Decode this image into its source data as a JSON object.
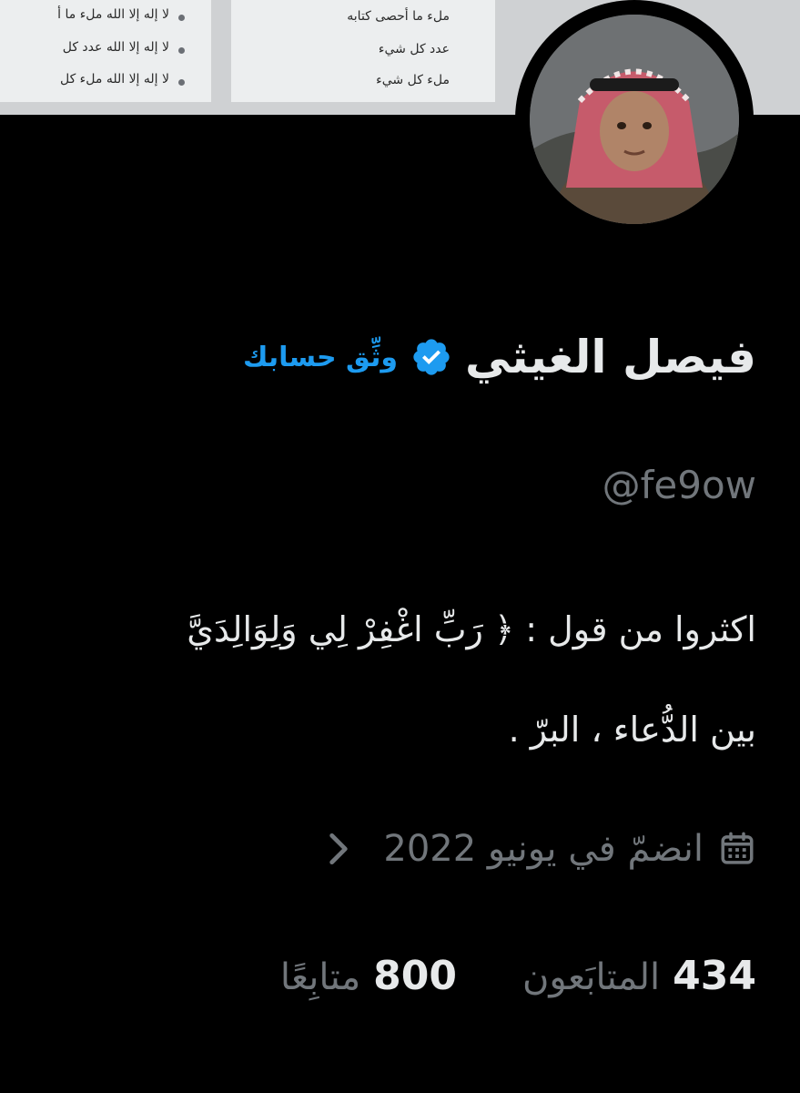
{
  "banner": {
    "left_lines": [
      "لا إله إلا الله ملء ما أ",
      "لا إله إلا الله عدد كل",
      "لا إله إلا الله ملء كل"
    ],
    "right_lines": [
      "ملء ما أحصى كتابه",
      "عدد كل شيء",
      "ملء كل شيء"
    ]
  },
  "profile": {
    "display_name": "فيصل الغيثي",
    "verify_label": "وثِّق حسابك",
    "handle": "@fe9ow",
    "bio_lines": [
      "اكثروا من قول :   ﴿ رَبِّ اغْفِرْ لِي وَلِوَالِدَيَّ",
      "بين الدُّعاء ، البرّ ."
    ],
    "joined": "انضمّ في يونيو 2022"
  },
  "stats": {
    "followers_count": "434",
    "followers_label": "المتابَعون",
    "following_count": "800",
    "following_label": "متابِعًا"
  },
  "icons": {
    "verified": "verified-badge-icon",
    "calendar": "calendar-icon",
    "chevron": "chevron-right-icon"
  },
  "colors": {
    "background": "#000000",
    "text_primary": "#e7e9ea",
    "text_secondary": "#71767b",
    "accent": "#1d9bf0"
  }
}
